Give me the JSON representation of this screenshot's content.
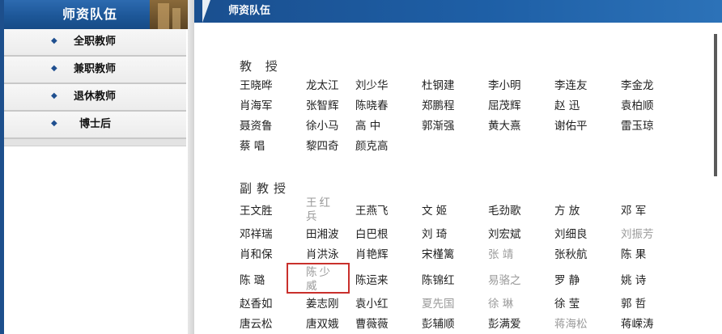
{
  "sidebar": {
    "title": "师资队伍",
    "items": [
      {
        "label": "全职教师"
      },
      {
        "label": "兼职教师"
      },
      {
        "label": "退休教师"
      },
      {
        "label": "博士后"
      }
    ]
  },
  "main": {
    "title": "师资队伍",
    "sections": [
      {
        "title": "教  授",
        "names": [
          "王晓晔",
          "龙太江",
          "刘少华",
          "杜钢建",
          "李小明",
          "李连友",
          "李金龙",
          "肖海军",
          "张智辉",
          "陈晓春",
          "郑鹏程",
          "屈茂辉",
          "赵  迅",
          "袁柏顺",
          "聂资鲁",
          "徐小马",
          "高  中",
          "郭渐强",
          "黄大熹",
          "谢佑平",
          "雷玉琼",
          "蔡  唱",
          "黎四奇",
          "颜克高"
        ]
      },
      {
        "title": "副教授",
        "names": [
          "王文胜",
          "王红兵",
          "王燕飞",
          "文  姬",
          "毛劲歌",
          "方  放",
          "邓  军",
          "邓祥瑞",
          "田湘波",
          "白巴根",
          "刘  琦",
          "刘宏斌",
          "刘细良",
          "刘振芳",
          "肖和保",
          "肖洪泳",
          "肖艳辉",
          "宋槿篱",
          "张  靖",
          "张秋航",
          "陈  果",
          "陈  璐",
          "陈少威",
          "陈运来",
          "陈锦红",
          "易骆之",
          "罗  静",
          "姚  诗",
          "赵香如",
          "姜志刚",
          "袁小红",
          "夏先国",
          "徐  琳",
          "徐  莹",
          "郭  哲",
          "唐云松",
          "唐双娥",
          "曹薇薇",
          "彭辅顺",
          "彭满爱",
          "蒋海松",
          "蒋嵘涛"
        ]
      }
    ]
  }
}
